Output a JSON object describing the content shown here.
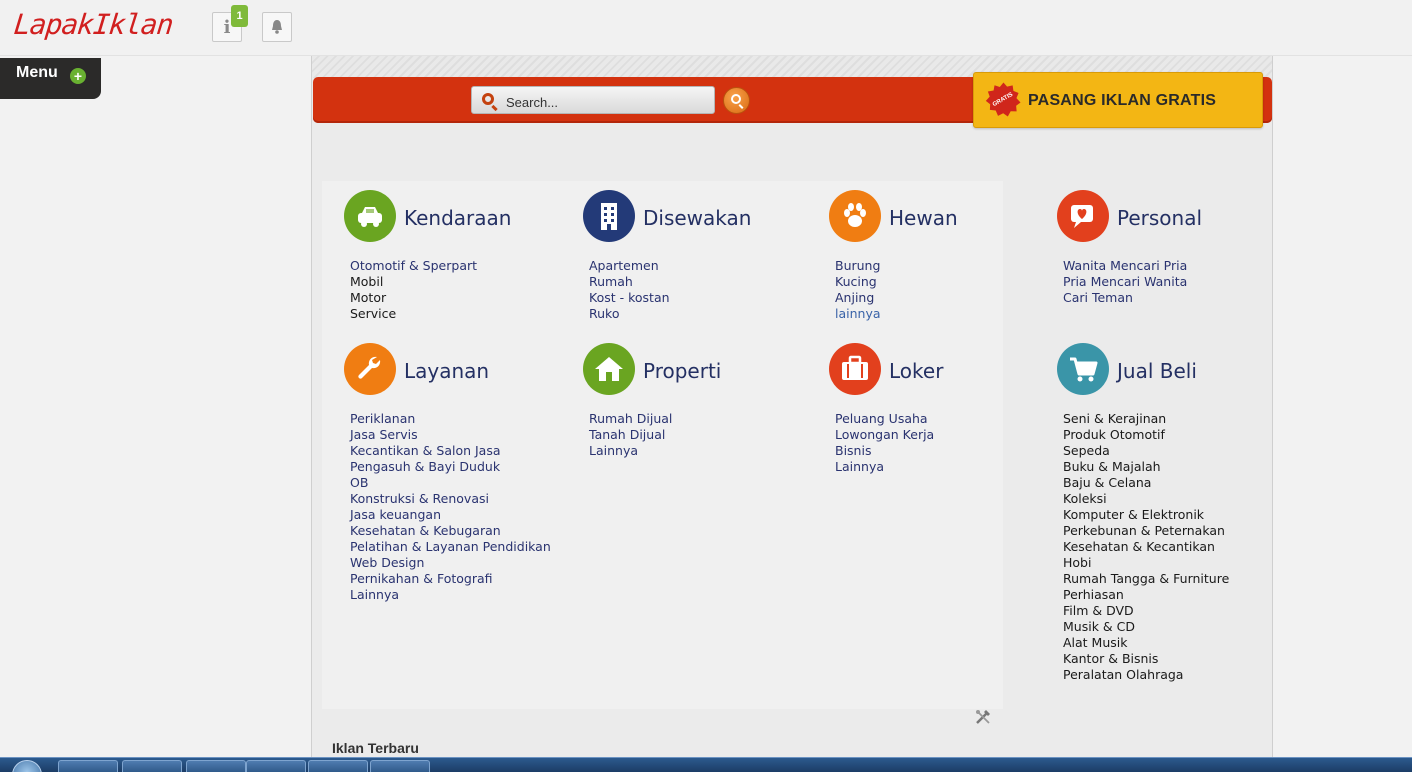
{
  "header": {
    "logo_text": "LapakIklan",
    "info_badge": "1",
    "info_glyph": "i",
    "bell_glyph": "🔔",
    "icons": [
      "info-icon",
      "bell-icon"
    ]
  },
  "menu": {
    "label": "Menu",
    "plus_glyph": "+"
  },
  "search": {
    "placeholder": "Search..."
  },
  "post_ad": {
    "label": "PASANG IKLAN GRATIS",
    "badge": "GRATIS"
  },
  "colors": {
    "brand_red": "#d3320f",
    "cta_yellow": "#f3b614",
    "link_blue": "#2a3370"
  },
  "categories": [
    {
      "title": "Kendaraan",
      "icon": "car-icon",
      "color": "#6aa521",
      "items": [
        "Otomotif & Sperpart",
        "Mobil",
        "Motor",
        "Service"
      ]
    },
    {
      "title": "Disewakan",
      "icon": "building-icon",
      "color": "#233a78",
      "items": [
        "Apartemen",
        "Rumah",
        "Kost - kostan",
        "Ruko"
      ]
    },
    {
      "title": "Hewan",
      "icon": "paw-icon",
      "color": "#f07d12",
      "items": [
        "Burung",
        "Kucing",
        "Anjing",
        "lainnya"
      ]
    },
    {
      "title": "Personal",
      "icon": "heart-chat-icon",
      "color": "#e2401d",
      "items": [
        "Wanita Mencari Pria",
        "Pria Mencari Wanita",
        "Cari Teman"
      ]
    },
    {
      "title": "Layanan",
      "icon": "wrench-icon",
      "color": "#f07d12",
      "items": [
        "Periklanan",
        "Jasa Servis",
        "Kecantikan & Salon Jasa",
        "Pengasuh & Bayi Duduk",
        "OB",
        "Konstruksi & Renovasi",
        "Jasa keuangan",
        "Kesehatan & Kebugaran",
        "Pelatihan & Layanan Pendidikan",
        "Web Design",
        "Pernikahan & Fotografi",
        "Lainnya"
      ]
    },
    {
      "title": "Properti",
      "icon": "house-icon",
      "color": "#6aa521",
      "items": [
        "Rumah Dijual",
        "Tanah Dijual",
        "Lainnya"
      ]
    },
    {
      "title": "Loker",
      "icon": "briefcase-icon",
      "color": "#e2401d",
      "items": [
        "Peluang Usaha",
        "Lowongan Kerja",
        "Bisnis",
        "Lainnya"
      ]
    },
    {
      "title": "Jual Beli",
      "icon": "cart-icon",
      "color": "#3a95a8",
      "items": [
        "Seni & Kerajinan",
        "Produk Otomotif",
        "Sepeda",
        "Buku & Majalah",
        "Baju & Celana",
        "Koleksi",
        "Komputer & Elektronik",
        "Perkebunan & Peternakan",
        "Kesehatan & Kecantikan",
        "Hobi",
        "Rumah Tangga & Furniture",
        "Perhiasan",
        "Film & DVD",
        "Musik & CD",
        "Alat Musik",
        "Kantor & Bisnis",
        "Peralatan Olahraga"
      ]
    }
  ],
  "latest": {
    "title": "Iklan Terbaru"
  },
  "taskbar": {
    "items": [
      "start-orb",
      "explorer",
      "firefox",
      "opera",
      "chrome",
      "notepad",
      "app"
    ]
  }
}
